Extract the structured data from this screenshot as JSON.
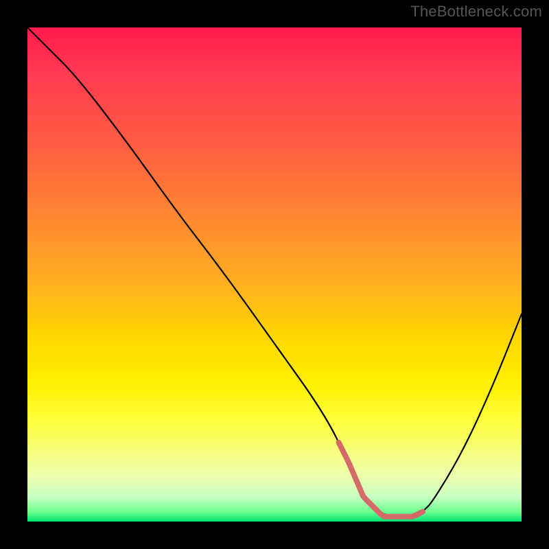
{
  "watermark": "TheBottleneck.com",
  "chart_data": {
    "type": "line",
    "title": "",
    "xlabel": "",
    "ylabel": "",
    "xlim": [
      0,
      100
    ],
    "ylim": [
      0,
      100
    ],
    "series": [
      {
        "name": "curve",
        "x": [
          0,
          4,
          10,
          20,
          30,
          40,
          50,
          60,
          65,
          68,
          72,
          78,
          80,
          82,
          88,
          94,
          100
        ],
        "values": [
          100,
          96,
          90,
          77,
          63,
          50,
          36,
          22,
          12,
          5,
          1,
          1,
          2,
          4,
          14,
          27,
          42
        ]
      }
    ],
    "highlight_segment": {
      "x_start": 63,
      "x_end": 80
    },
    "colors": {
      "curve": "#000000",
      "highlight": "#d46a6a",
      "background_top": "#ff1a4d",
      "background_bottom": "#00e070",
      "frame": "#000000"
    }
  }
}
